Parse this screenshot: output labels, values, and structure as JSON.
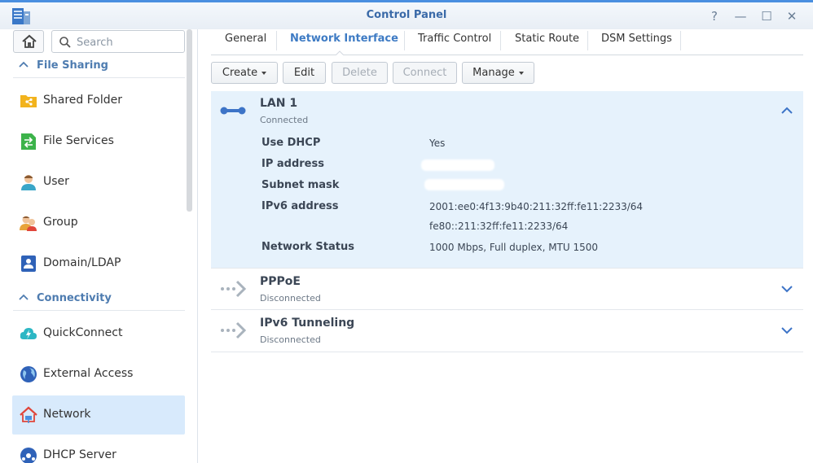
{
  "window": {
    "title": "Control Panel",
    "help_glyph": "?",
    "minimize_glyph": "—",
    "maximize_glyph": "☐",
    "close_glyph": "✕"
  },
  "sidebar": {
    "search_placeholder": "Search",
    "sections": [
      {
        "label": "File Sharing",
        "items": [
          {
            "label": "Shared Folder",
            "icon": "shared-folder-icon"
          },
          {
            "label": "File Services",
            "icon": "file-services-icon"
          },
          {
            "label": "User",
            "icon": "user-icon"
          },
          {
            "label": "Group",
            "icon": "group-icon"
          },
          {
            "label": "Domain/LDAP",
            "icon": "domain-ldap-icon"
          }
        ]
      },
      {
        "label": "Connectivity",
        "items": [
          {
            "label": "QuickConnect",
            "icon": "quickconnect-icon"
          },
          {
            "label": "External Access",
            "icon": "external-access-icon"
          },
          {
            "label": "Network",
            "icon": "network-icon",
            "active": true
          },
          {
            "label": "DHCP Server",
            "icon": "dhcp-server-icon"
          }
        ]
      }
    ]
  },
  "tabs": [
    {
      "label": "General"
    },
    {
      "label": "Network Interface",
      "active": true
    },
    {
      "label": "Traffic Control"
    },
    {
      "label": "Static Route"
    },
    {
      "label": "DSM Settings"
    }
  ],
  "toolbar": {
    "create": "Create",
    "edit": "Edit",
    "delete": "Delete",
    "connect": "Connect",
    "manage": "Manage"
  },
  "interfaces": [
    {
      "name": "LAN 1",
      "status": "Connected",
      "expanded": true,
      "details": {
        "use_dhcp_label": "Use DHCP",
        "use_dhcp_value": "Yes",
        "ip_label": "IP address",
        "subnet_label": "Subnet mask",
        "ipv6_label": "IPv6 address",
        "ipv6_value_1": "2001:ee0:4f13:9b40:211:32ff:fe11:2233/64",
        "ipv6_value_2": "fe80::211:32ff:fe11:2233/64",
        "status_label": "Network Status",
        "status_value": "1000 Mbps, Full duplex, MTU 1500"
      }
    },
    {
      "name": "PPPoE",
      "status": "Disconnected",
      "expanded": false
    },
    {
      "name": "IPv6 Tunneling",
      "status": "Disconnected",
      "expanded": false
    }
  ],
  "colors": {
    "accent": "#3e7bc4",
    "active_nav_bg": "#d8eafc",
    "expanded_row_bg": "#e6f2fc"
  }
}
